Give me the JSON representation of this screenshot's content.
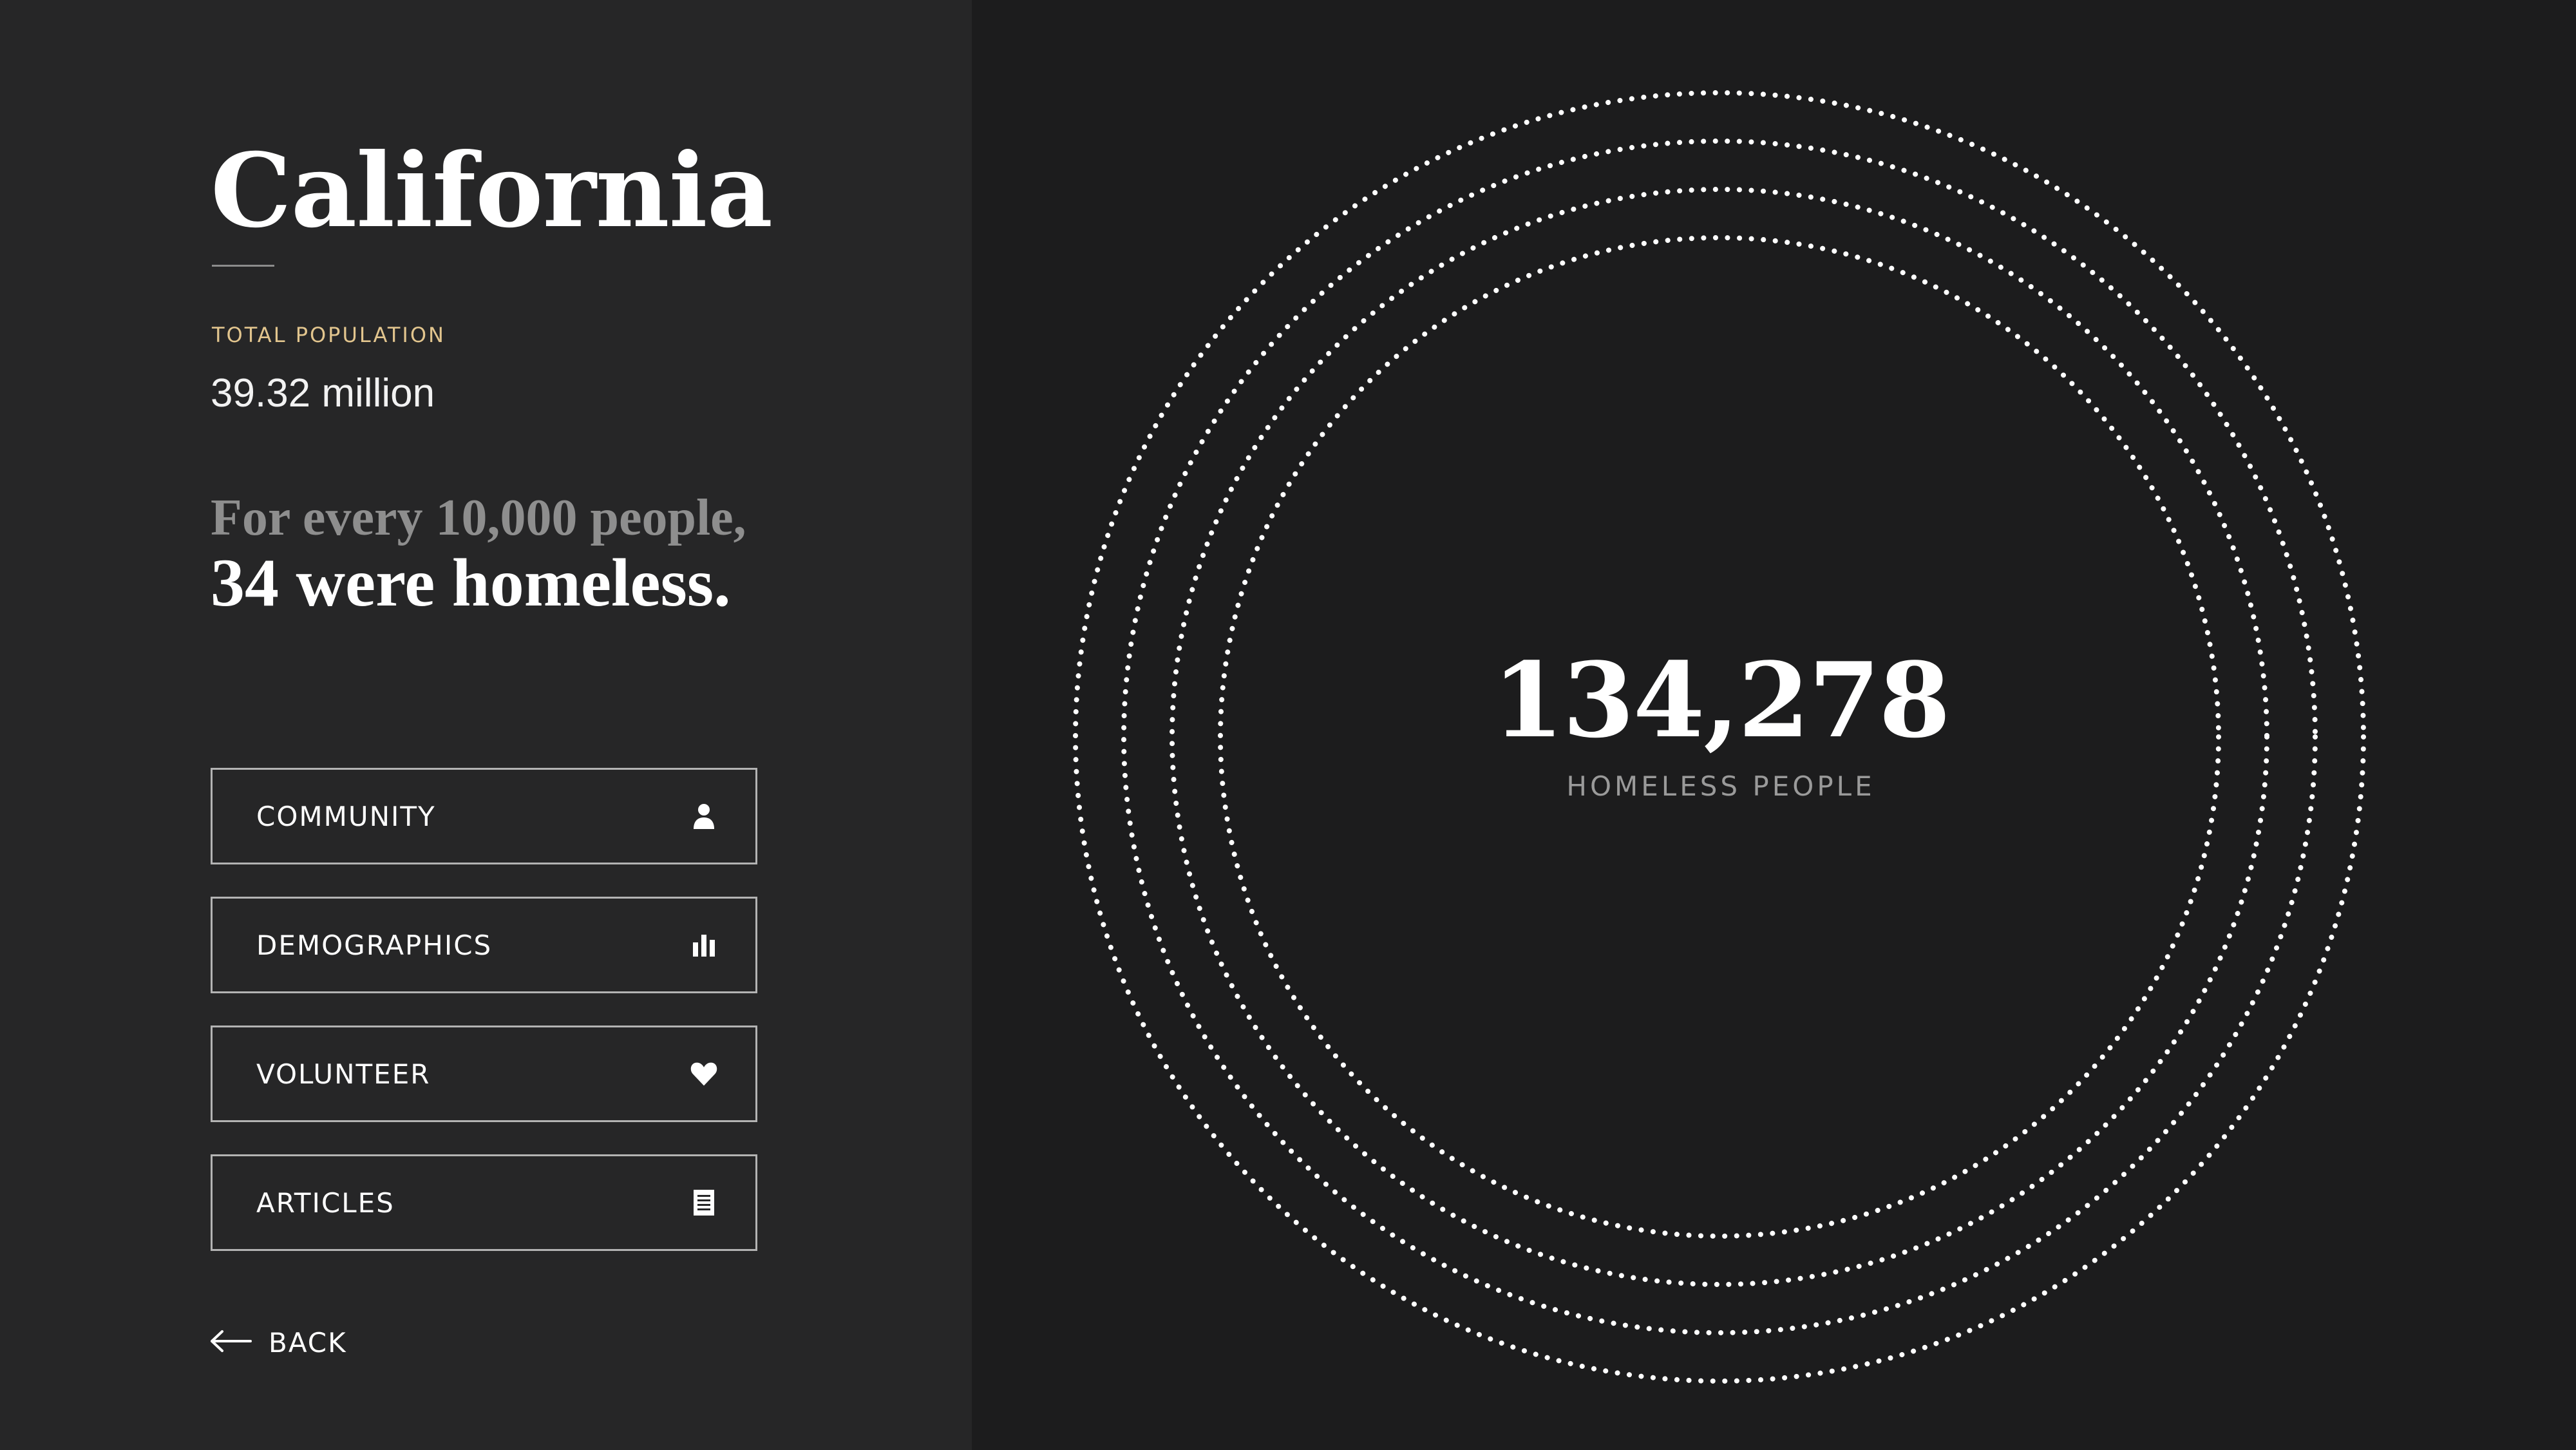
{
  "state": {
    "name": "California",
    "population_label": "TOTAL POPULATION",
    "population_value": "39.32 million",
    "rate_line1": "For every 10,000 people,",
    "rate_line2": "34 were homeless."
  },
  "nav": {
    "items": [
      {
        "label": "COMMUNITY",
        "icon": "person-icon"
      },
      {
        "label": "DEMOGRAPHICS",
        "icon": "bar-chart-icon"
      },
      {
        "label": "VOLUNTEER",
        "icon": "heart-icon"
      },
      {
        "label": "ARTICLES",
        "icon": "document-icon"
      }
    ],
    "back_label": "BACK",
    "back_icon": "arrow-left-icon"
  },
  "highlight": {
    "count": "134,278",
    "caption": "HOMELESS PEOPLE"
  },
  "colors": {
    "sidebar_bg": "#262627",
    "main_bg": "#1c1c1d",
    "accent_gold": "#e2c58e",
    "text_white": "#ffffff",
    "text_muted": "#8e8e8e",
    "button_border": "#b3b3b3"
  }
}
